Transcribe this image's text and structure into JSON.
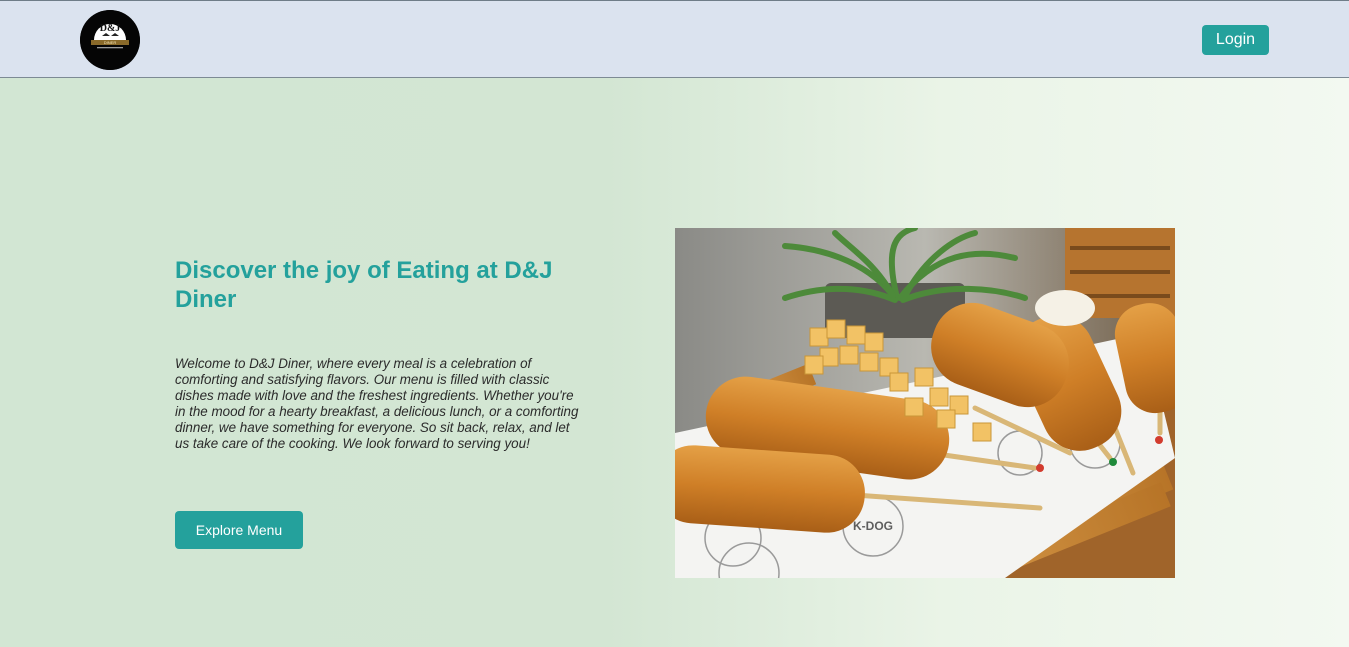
{
  "header": {
    "logo_text": "D&J",
    "logo_subtext": "DINER",
    "login_label": "Login"
  },
  "hero": {
    "title": "Discover the joy of Eating at D&J Diner",
    "description": "Welcome to D&J Diner, where every meal is a celebration of comforting and satisfying flavors. Our menu is filled with classic dishes made with love and the freshest ingredients. Whether you're in the mood for a hearty breakfast, a delicious lunch, or a comforting dinner, we have something for everyone. So sit back, relax, and let us take care of the cooking. We look forward to serving you!",
    "button_label": "Explore Menu",
    "image_text": "K-DOG"
  },
  "colors": {
    "accent": "#24a19c",
    "navbar": "#dbe3ef",
    "hero_bg_left": "#d2e6d3",
    "hero_bg_right": "#f3f9f1"
  }
}
